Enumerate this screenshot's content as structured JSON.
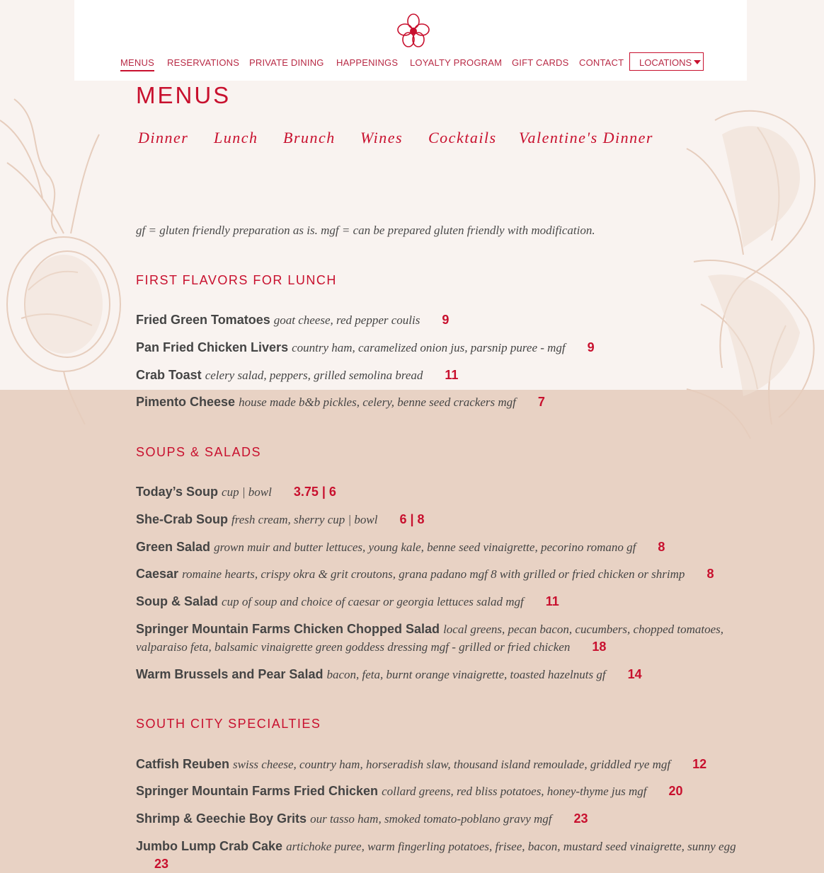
{
  "nav": {
    "items": [
      "MENUS",
      "RESERVATIONS",
      "PRIVATE DINING",
      "HAPPENINGS",
      "LOYALTY PROGRAM",
      "GIFT CARDS",
      "CONTACT"
    ],
    "locations_label": "LOCATIONS"
  },
  "page_title": "MENUS",
  "tabs": [
    "Dinner",
    "Lunch",
    "Brunch",
    "Wines",
    "Cocktails",
    "Valentine's Dinner"
  ],
  "note": "gf = gluten friendly preparation as is. mgf = can be prepared gluten friendly with modification.",
  "sections": [
    {
      "title": "FIRST FLAVORS FOR LUNCH",
      "items": [
        {
          "name": "Fried Green Tomatoes",
          "desc": "goat cheese, red pepper coulis",
          "price": "9"
        },
        {
          "name": "Pan Fried Chicken Livers",
          "desc": "country ham, caramelized onion jus, parsnip puree - mgf",
          "price": "9"
        },
        {
          "name": "Crab Toast",
          "desc": "celery salad, peppers, grilled semolina bread",
          "price": "11"
        },
        {
          "name": "Pimento Cheese",
          "desc": "house made b&b pickles, celery, benne seed crackers mgf",
          "price": "7"
        }
      ]
    },
    {
      "title": "SOUPS & SALADS",
      "items": [
        {
          "name": "Today’s Soup",
          "desc": "cup | bowl",
          "price": "3.75 | 6"
        },
        {
          "name": "She-Crab Soup",
          "desc": "fresh cream, sherry cup | bowl",
          "price": "6 | 8"
        },
        {
          "name": "Green Salad",
          "desc": "grown muir and butter lettuces, young kale, benne seed vinaigrette, pecorino romano gf",
          "price": "8"
        },
        {
          "name": "Caesar",
          "desc": "romaine hearts, crispy okra & grit croutons, grana padano mgf 8 with grilled or fried chicken or shrimp",
          "price": "8"
        },
        {
          "name": "Soup & Salad",
          "desc": "cup of soup and choice of caesar or georgia lettuces salad mgf",
          "price": "11"
        },
        {
          "name": "Springer Mountain Farms Chicken Chopped Salad",
          "desc": "local greens, pecan bacon, cucumbers, chopped tomatoes, valparaiso feta, balsamic vinaigrette green goddess dressing mgf - grilled or fried chicken",
          "price": "18"
        },
        {
          "name": "Warm Brussels and Pear Salad",
          "desc": "bacon, feta, burnt orange vinaigrette, toasted hazelnuts gf",
          "price": "14"
        }
      ]
    },
    {
      "title": "SOUTH CITY SPECIALTIES",
      "items": [
        {
          "name": "Catfish Reuben",
          "desc": "swiss cheese, country ham, horseradish slaw, thousand island remoulade, griddled rye mgf",
          "price": "12"
        },
        {
          "name": "Springer Mountain Farms Fried Chicken",
          "desc": "collard greens, red bliss potatoes, honey-thyme jus mgf",
          "price": "20"
        },
        {
          "name": "Shrimp & Geechie Boy Grits",
          "desc": "our tasso ham, smoked tomato-poblano gravy mgf",
          "price": "23"
        },
        {
          "name": "Jumbo Lump Crab Cake",
          "desc": "artichoke puree, warm fingerling potatoes, frisee, bacon, mustard seed vinaigrette, sunny egg",
          "price": "23"
        }
      ]
    }
  ]
}
